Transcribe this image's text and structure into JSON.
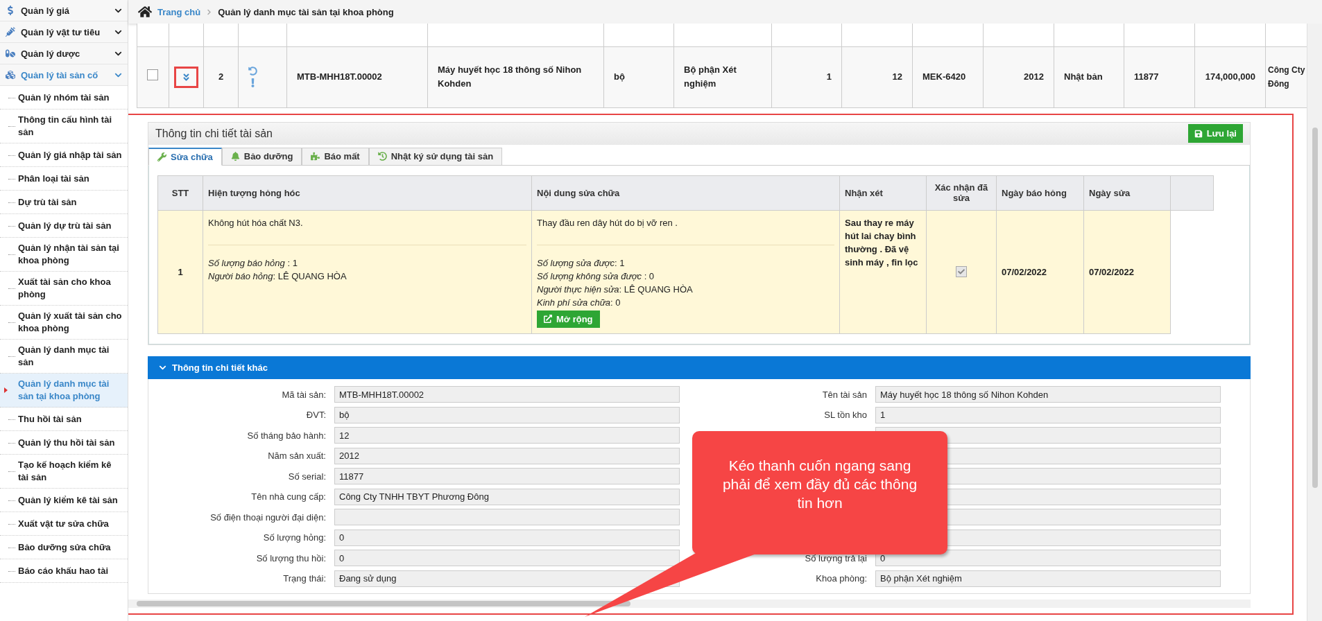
{
  "breadcrumb": {
    "home": "Trang chủ",
    "current": "Quản lý danh mục tài sản tại khoa phòng"
  },
  "sidebar": {
    "groups": [
      {
        "label": "Quản lý giá",
        "expanded": false
      },
      {
        "label": "Quản lý vật tư tiêu",
        "expanded": false
      },
      {
        "label": "Quản lý dược",
        "expanded": false
      },
      {
        "label": "Quản lý tài sản cố",
        "expanded": true,
        "children": [
          {
            "label": "Quản lý nhóm tài sản",
            "selected": false
          },
          {
            "label": "Thông tin cấu hình tài sản",
            "selected": false
          },
          {
            "label": "Quản lý giá nhập tài sản",
            "selected": false
          },
          {
            "label": "Phân loại tài sản",
            "selected": false
          },
          {
            "label": "Dự trù tài sản",
            "selected": false
          },
          {
            "label": "Quản lý dự trù tài sản",
            "selected": false
          },
          {
            "label": "Quản lý nhận tài sản tại khoa phòng",
            "selected": false
          },
          {
            "label": "Xuất tài sản cho khoa phòng",
            "selected": false
          },
          {
            "label": "Quản lý xuất tài sản cho khoa phòng",
            "selected": false
          },
          {
            "label": "Quản lý danh mục tài sản",
            "selected": false
          },
          {
            "label": "Quản lý danh mục tài sản tại khoa phòng",
            "selected": true
          },
          {
            "label": "Thu hồi tài sản",
            "selected": false
          },
          {
            "label": "Quản lý thu hồi tài sản",
            "selected": false
          },
          {
            "label": "Tạo kế hoạch kiểm kê tài sản",
            "selected": false
          },
          {
            "label": "Quản lý kiểm kê tài sản",
            "selected": false
          },
          {
            "label": "Xuất vật tư sửa chữa",
            "selected": false
          },
          {
            "label": "Bảo dưỡng sửa chữa",
            "selected": false
          },
          {
            "label": "Báo cáo khấu hao tài",
            "selected": false
          }
        ]
      }
    ]
  },
  "asset_table": {
    "rows": [
      {
        "checked": false,
        "expanded": true,
        "cells": [
          "2",
          "MTB-MHH18T.00002",
          "Máy huyết học 18 thông số Nihon Kohden",
          "bộ",
          "Bộ phận Xét nghiệm",
          "1",
          "12",
          "MEK-6420",
          "2012",
          "Nhật bản",
          "11877",
          "174,000,000",
          "Công Cty Đông"
        ]
      }
    ]
  },
  "detail": {
    "title": "Thông tin chi tiết tài sản",
    "save_button": "Lưu lại",
    "tabs": [
      {
        "label": "Sửa chữa",
        "selected": true
      },
      {
        "label": "Bảo dưỡng",
        "selected": false
      },
      {
        "label": "Báo mất",
        "selected": false
      },
      {
        "label": "Nhật ký sử dụng tài sản",
        "selected": false
      }
    ],
    "repair_table": {
      "columns": [
        "STT",
        "Hiện tượng hỏng hóc",
        "Nội dung sửa chữa",
        "Nhận xét",
        "Xác nhận đã sửa",
        "Ngày báo hỏng",
        "Ngày sửa"
      ],
      "rows": [
        {
          "stt": "1",
          "issue": "Không hút hóa chất N3.",
          "issue_details": [
            "*Số lượng báo hỏng* : 1",
            "*Người báo hỏng*: LÊ QUANG HÒA"
          ],
          "repair": "Thay đầu ren dây hút do bị vỡ ren .",
          "repair_details": [
            "*Số lượng sửa được*: 1",
            "*Số lượng không sửa được* : 0",
            "*Người thực hiện sửa*: LÊ QUANG HÒA",
            "*Kinh phí sửa chữa*: 0"
          ],
          "more_button": "Mở rộng",
          "remark": "Sau thay re máy hút lai chay bình thường . Đã vệ sinh máy , fin lọc",
          "confirmed": true,
          "reported_date": "07/02/2022",
          "repair_date": "07/02/2022"
        }
      ]
    }
  },
  "other_info": {
    "title": "Thông tin chi tiết khác",
    "expanded": true,
    "left_fields": [
      {
        "label": "Mã tài sản:",
        "value": "MTB-MHH18T.00002"
      },
      {
        "label": "ĐVT:",
        "value": "bộ"
      },
      {
        "label": "Số tháng bảo hành:",
        "value": "12"
      },
      {
        "label": "Năm sản xuất:",
        "value": "2012"
      },
      {
        "label": "Số serial:",
        "value": "11877"
      },
      {
        "label": "Tên nhà cung cấp:",
        "value": "Công Cty TNHH TBYT Phương Đông"
      },
      {
        "label": "Số điện thoại người đại diện:"
      },
      {
        "label": "Số lượng hỏng:",
        "value": "0"
      },
      {
        "label": "Số lượng thu hồi:",
        "value": "0"
      },
      {
        "label": "Trạng thái:",
        "value": "Đang sử dụng"
      }
    ],
    "right_fields": [
      {
        "kind": "field",
        "label": "Tên tài sản",
        "value": "Máy huyết học 18 thông số Nihon Kohden"
      },
      {
        "kind": "field",
        "label": "SL tồn kho",
        "value": "1"
      },
      {
        "kind": "blank"
      },
      {
        "kind": "blank"
      },
      {
        "kind": "blank"
      },
      {
        "kind": "blank"
      },
      {
        "kind": "blank"
      },
      {
        "kind": "blank"
      },
      {
        "kind": "field",
        "label": "Số lượng trả lại",
        "value": "0"
      },
      {
        "kind": "field",
        "label": "Khoa phòng:",
        "value": "Bộ phận Xét nghiệm"
      }
    ]
  },
  "callout": {
    "text": "Kéo thanh cuốn ngang sang phải để xem đầy đủ các thông tin hơn"
  }
}
